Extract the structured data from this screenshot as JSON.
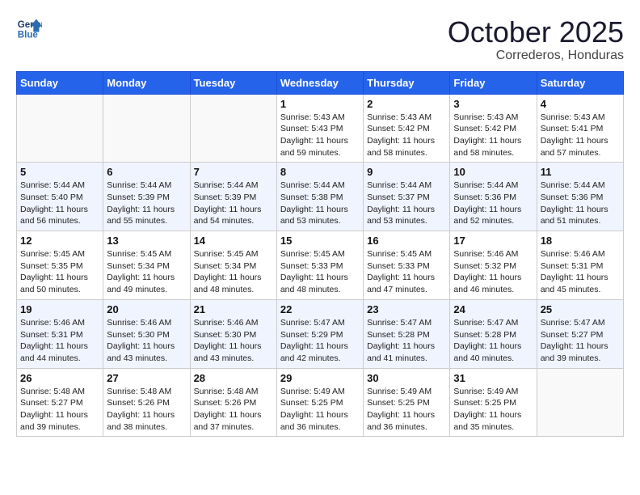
{
  "header": {
    "logo_line1": "General",
    "logo_line2": "Blue",
    "month_title": "October 2025",
    "location": "Correderos, Honduras"
  },
  "weekdays": [
    "Sunday",
    "Monday",
    "Tuesday",
    "Wednesday",
    "Thursday",
    "Friday",
    "Saturday"
  ],
  "weeks": [
    [
      {
        "day": "",
        "info": ""
      },
      {
        "day": "",
        "info": ""
      },
      {
        "day": "",
        "info": ""
      },
      {
        "day": "1",
        "info": "Sunrise: 5:43 AM\nSunset: 5:43 PM\nDaylight: 11 hours\nand 59 minutes."
      },
      {
        "day": "2",
        "info": "Sunrise: 5:43 AM\nSunset: 5:42 PM\nDaylight: 11 hours\nand 58 minutes."
      },
      {
        "day": "3",
        "info": "Sunrise: 5:43 AM\nSunset: 5:42 PM\nDaylight: 11 hours\nand 58 minutes."
      },
      {
        "day": "4",
        "info": "Sunrise: 5:43 AM\nSunset: 5:41 PM\nDaylight: 11 hours\nand 57 minutes."
      }
    ],
    [
      {
        "day": "5",
        "info": "Sunrise: 5:44 AM\nSunset: 5:40 PM\nDaylight: 11 hours\nand 56 minutes."
      },
      {
        "day": "6",
        "info": "Sunrise: 5:44 AM\nSunset: 5:39 PM\nDaylight: 11 hours\nand 55 minutes."
      },
      {
        "day": "7",
        "info": "Sunrise: 5:44 AM\nSunset: 5:39 PM\nDaylight: 11 hours\nand 54 minutes."
      },
      {
        "day": "8",
        "info": "Sunrise: 5:44 AM\nSunset: 5:38 PM\nDaylight: 11 hours\nand 53 minutes."
      },
      {
        "day": "9",
        "info": "Sunrise: 5:44 AM\nSunset: 5:37 PM\nDaylight: 11 hours\nand 53 minutes."
      },
      {
        "day": "10",
        "info": "Sunrise: 5:44 AM\nSunset: 5:36 PM\nDaylight: 11 hours\nand 52 minutes."
      },
      {
        "day": "11",
        "info": "Sunrise: 5:44 AM\nSunset: 5:36 PM\nDaylight: 11 hours\nand 51 minutes."
      }
    ],
    [
      {
        "day": "12",
        "info": "Sunrise: 5:45 AM\nSunset: 5:35 PM\nDaylight: 11 hours\nand 50 minutes."
      },
      {
        "day": "13",
        "info": "Sunrise: 5:45 AM\nSunset: 5:34 PM\nDaylight: 11 hours\nand 49 minutes."
      },
      {
        "day": "14",
        "info": "Sunrise: 5:45 AM\nSunset: 5:34 PM\nDaylight: 11 hours\nand 48 minutes."
      },
      {
        "day": "15",
        "info": "Sunrise: 5:45 AM\nSunset: 5:33 PM\nDaylight: 11 hours\nand 48 minutes."
      },
      {
        "day": "16",
        "info": "Sunrise: 5:45 AM\nSunset: 5:33 PM\nDaylight: 11 hours\nand 47 minutes."
      },
      {
        "day": "17",
        "info": "Sunrise: 5:46 AM\nSunset: 5:32 PM\nDaylight: 11 hours\nand 46 minutes."
      },
      {
        "day": "18",
        "info": "Sunrise: 5:46 AM\nSunset: 5:31 PM\nDaylight: 11 hours\nand 45 minutes."
      }
    ],
    [
      {
        "day": "19",
        "info": "Sunrise: 5:46 AM\nSunset: 5:31 PM\nDaylight: 11 hours\nand 44 minutes."
      },
      {
        "day": "20",
        "info": "Sunrise: 5:46 AM\nSunset: 5:30 PM\nDaylight: 11 hours\nand 43 minutes."
      },
      {
        "day": "21",
        "info": "Sunrise: 5:46 AM\nSunset: 5:30 PM\nDaylight: 11 hours\nand 43 minutes."
      },
      {
        "day": "22",
        "info": "Sunrise: 5:47 AM\nSunset: 5:29 PM\nDaylight: 11 hours\nand 42 minutes."
      },
      {
        "day": "23",
        "info": "Sunrise: 5:47 AM\nSunset: 5:28 PM\nDaylight: 11 hours\nand 41 minutes."
      },
      {
        "day": "24",
        "info": "Sunrise: 5:47 AM\nSunset: 5:28 PM\nDaylight: 11 hours\nand 40 minutes."
      },
      {
        "day": "25",
        "info": "Sunrise: 5:47 AM\nSunset: 5:27 PM\nDaylight: 11 hours\nand 39 minutes."
      }
    ],
    [
      {
        "day": "26",
        "info": "Sunrise: 5:48 AM\nSunset: 5:27 PM\nDaylight: 11 hours\nand 39 minutes."
      },
      {
        "day": "27",
        "info": "Sunrise: 5:48 AM\nSunset: 5:26 PM\nDaylight: 11 hours\nand 38 minutes."
      },
      {
        "day": "28",
        "info": "Sunrise: 5:48 AM\nSunset: 5:26 PM\nDaylight: 11 hours\nand 37 minutes."
      },
      {
        "day": "29",
        "info": "Sunrise: 5:49 AM\nSunset: 5:25 PM\nDaylight: 11 hours\nand 36 minutes."
      },
      {
        "day": "30",
        "info": "Sunrise: 5:49 AM\nSunset: 5:25 PM\nDaylight: 11 hours\nand 36 minutes."
      },
      {
        "day": "31",
        "info": "Sunrise: 5:49 AM\nSunset: 5:25 PM\nDaylight: 11 hours\nand 35 minutes."
      },
      {
        "day": "",
        "info": ""
      }
    ]
  ]
}
